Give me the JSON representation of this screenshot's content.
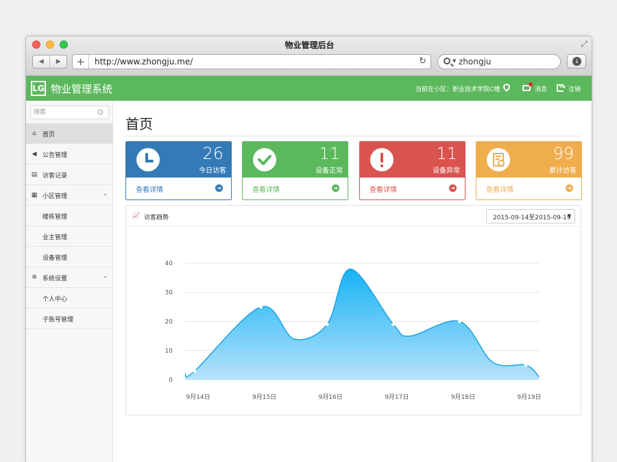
{
  "browser": {
    "window_title": "物业管理后台",
    "url": "http://www.zhongju.me/",
    "search_text": "zhongju"
  },
  "header": {
    "logo_text": "LG",
    "app_title": "物业管理系统",
    "community_label": "当前在小区：职业技术学院C幢",
    "messages_label": "消息",
    "logout_label": "注销",
    "accent_color": "#5cb85c"
  },
  "sidebar": {
    "search_placeholder": "搜索",
    "items": [
      {
        "label": "首页",
        "icon": "home-icon",
        "active": true
      },
      {
        "label": "公告管理",
        "icon": "megaphone-icon"
      },
      {
        "label": "访客记录",
        "icon": "clipboard-icon"
      },
      {
        "label": "小区管理",
        "icon": "building-icon",
        "expandable": true
      },
      {
        "label": "楼栋管理",
        "sub": true
      },
      {
        "label": "业主管理",
        "sub": true
      },
      {
        "label": "设备管理",
        "sub": true
      },
      {
        "label": "系统设置",
        "icon": "gear-icon",
        "expandable": true
      },
      {
        "label": "个人中心",
        "sub": true
      },
      {
        "label": "子账号管理",
        "sub": true
      }
    ]
  },
  "main": {
    "page_title": "首页",
    "cards": [
      {
        "value": "26",
        "label": "今日访客",
        "link": "查看详情",
        "color": "#337ab7",
        "icon": "clock-icon"
      },
      {
        "value": "11",
        "label": "设备正常",
        "link": "查看详情",
        "color": "#5cb85c",
        "icon": "check-icon"
      },
      {
        "value": "11",
        "label": "设备异常",
        "link": "查看详情",
        "color": "#d9534f",
        "icon": "alert-icon"
      },
      {
        "value": "99",
        "label": "累计访客",
        "link": "查看详情",
        "color": "#f0ad4e",
        "icon": "report-icon"
      }
    ],
    "chart_panel": {
      "title": "访客趋势",
      "date_range": "2015-09-14至2015-09-19"
    }
  },
  "chart_data": {
    "type": "area",
    "title": "",
    "xlabel": "",
    "ylabel": "",
    "categories": [
      "9月14日",
      "9月15日",
      "9月16日",
      "9月17日",
      "9月18日",
      "9月19日"
    ],
    "y_ticks": [
      0,
      10,
      20,
      30,
      40
    ],
    "ylim": [
      0,
      40
    ],
    "grid": true,
    "series": [
      {
        "color": "#1ba1e2",
        "points": [
          {
            "x": 0,
            "y": 3
          },
          {
            "x": 1,
            "y": 25
          },
          {
            "x": 1.5,
            "y": 14
          },
          {
            "x": 2,
            "y": 19
          },
          {
            "x": 2.35,
            "y": 38
          },
          {
            "x": 3,
            "y": 19
          },
          {
            "x": 3.25,
            "y": 15
          },
          {
            "x": 4,
            "y": 20
          },
          {
            "x": 4.5,
            "y": 6
          },
          {
            "x": 5,
            "y": 5
          },
          {
            "x": 5.2,
            "y": 1
          }
        ]
      }
    ]
  }
}
